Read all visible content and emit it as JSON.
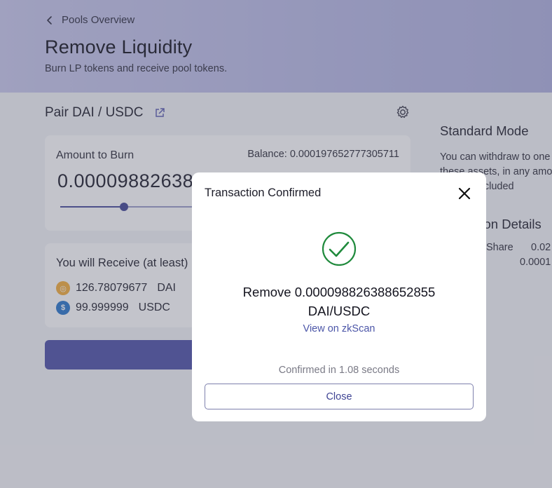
{
  "header": {
    "back_label": "Pools Overview",
    "title": "Remove Liquidity",
    "subtitle": "Burn LP tokens and receive pool tokens."
  },
  "pair": {
    "label": "Pair DAI / USDC"
  },
  "burn": {
    "amount_label": "Amount to Burn",
    "balance": "Balance: 0.000197652777305711",
    "amount_value": "0.000098826388652855",
    "slider_fraction": 0.19
  },
  "receive": {
    "title": "You will Receive (at least)",
    "tokens": [
      {
        "amount": "126.78079677",
        "symbol": "DAI",
        "icon": "dai-icon"
      },
      {
        "amount": "99.999999",
        "symbol": "USDC",
        "icon": "usdc-icon"
      }
    ]
  },
  "sidebar": {
    "title": "Standard Mode",
    "lines": [
      "You can withdraw to one",
      "these assets, in any amo",
      "already included"
    ],
    "details_title": "ction Details",
    "share_label": "Share",
    "share_value": "0.02",
    "share_value_2": "0.0001"
  },
  "modal": {
    "title": "Transaction Confirmed",
    "line1": "Remove 0.000098826388652855",
    "line2": "DAI/USDC",
    "view_link": "View on zkScan",
    "confirmed_text": "Confirmed in 1.08 seconds",
    "close_label": "Close"
  },
  "colors": {
    "accent": "#4c4fa6",
    "success": "#1f8a3c",
    "header_gradient_start": "#c8c8ec",
    "header_gradient_end": "#aeb0de"
  }
}
